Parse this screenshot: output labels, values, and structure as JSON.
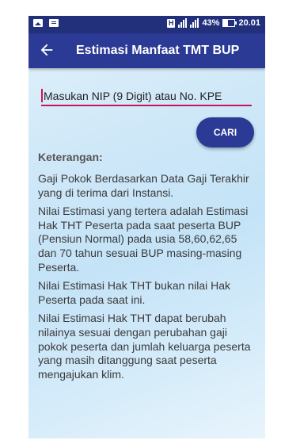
{
  "status": {
    "battery": "43%",
    "time": "20.01",
    "network": "H"
  },
  "appbar": {
    "title": "Estimasi Manfaat TMT BUP"
  },
  "form": {
    "input_placeholder": "Masukan NIP (9 Digit) atau No. KPE",
    "button_label": "CARI"
  },
  "keterangan": {
    "heading": "Keterangan:",
    "paragraphs": [
      "Gaji Pokok Berdasarkan Data Gaji Terakhir yang di terima dari Instansi.",
      "Nilai Estimasi yang tertera adalah Estimasi Hak THT Peserta pada saat peserta BUP (Pensiun Normal) pada usia 58,60,62,65 dan 70 tahun sesuai BUP masing-masing Peserta.",
      "Nilai Estimasi Hak THT bukan nilai Hak Peserta pada saat ini.",
      "Nilai Estimasi Hak THT dapat berubah nilainya sesuai dengan perubahan gaji pokok peserta dan jumlah keluarga peserta yang masih ditanggung saat peserta mengajukan klim."
    ]
  },
  "colors": {
    "statusbar": "#22307c",
    "appbar": "#2b3a94",
    "accent": "#c2185b"
  }
}
